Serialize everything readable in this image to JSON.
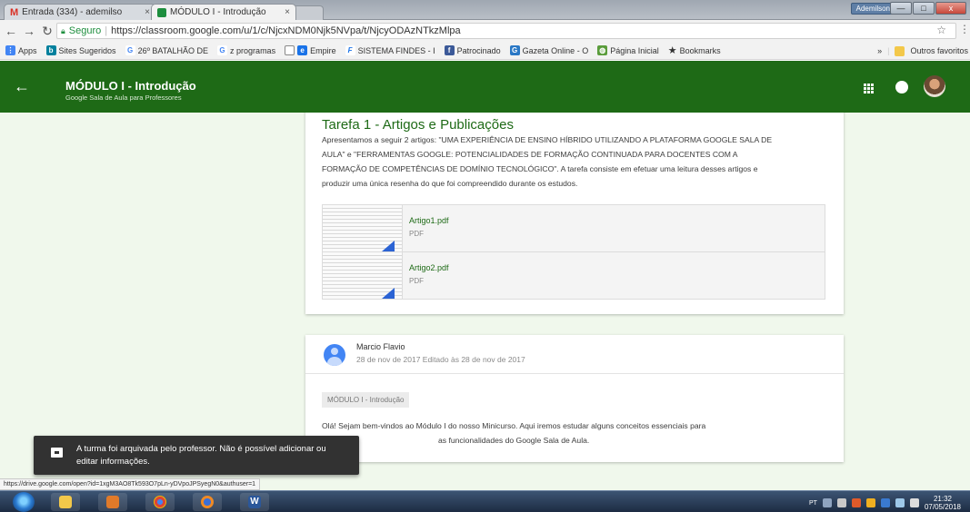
{
  "browser": {
    "tabs": [
      {
        "label": "Entrada (334) - ademilso",
        "icon": "gmail-icon"
      },
      {
        "label": "MÓDULO I - Introdução",
        "icon": "classroom-icon"
      }
    ],
    "user_chip": "Ademilson",
    "window_buttons": {
      "minimize": "—",
      "maximize": "□",
      "close": "x"
    },
    "secure_label": "Seguro",
    "url": "https://classroom.google.com/u/1/c/NjcxNDM0Njk5NVpa/t/NjcyODAzNTkzMlpa",
    "bookmarks": [
      {
        "label": "Apps",
        "icon": "apps-grid-icon",
        "color": "#4285f4"
      },
      {
        "label": "Sites Sugeridos",
        "icon": "bing-icon",
        "color": "#00809d"
      },
      {
        "label": "26º BATALHÃO DE",
        "icon": "google-g-icon",
        "color": "#4285f4"
      },
      {
        "label": "z programas",
        "icon": "google-g-icon",
        "color": "#4285f4"
      },
      {
        "label": "Empire",
        "icon": "page-icon",
        "color": "#888888"
      },
      {
        "label": "SISTEMA FINDES - I",
        "icon": "findes-icon",
        "color": "#1a73e8"
      },
      {
        "label": "Patrocinado",
        "icon": "facebook-icon",
        "color": "#3b5998"
      },
      {
        "label": "Gazeta Online - O",
        "icon": "gazeta-icon",
        "color": "#2a78c5"
      },
      {
        "label": "Página Inicial",
        "icon": "globe-icon",
        "color": "#5a9c3b"
      },
      {
        "label": "Bookmarks",
        "icon": "star-icon",
        "color": "#333333"
      }
    ],
    "bookmarks_more": "»",
    "bookmarks_other": "Outros favoritos"
  },
  "header": {
    "title": "MÓDULO I - Introdução",
    "subtitle": "Google Sala de Aula para Professores"
  },
  "assignment": {
    "title": "Tarefa 1 - Artigos e Publicações",
    "description": "Apresentamos a seguir 2 artigos: \"UMA EXPERIÊNCIA DE ENSINO HÍBRIDO UTILIZANDO A PLATAFORMA GOOGLE SALA DE AULA\" e \"FERRAMENTAS GOOGLE: POTENCIALIDADES DE FORMAÇÃO CONTINUADA PARA DOCENTES COM A FORMAÇÃO DE COMPETÊNCIAS DE DOMÍNIO TECNOLÓGICO\". A tarefa consiste em efetuar uma leitura desses artigos e produzir uma única resenha do que foi compreendido durante os estudos.",
    "attachments": [
      {
        "name": "Artigo1.pdf",
        "type": "PDF"
      },
      {
        "name": "Artigo2.pdf",
        "type": "PDF"
      }
    ]
  },
  "post": {
    "author": "Marcio Flavio",
    "date": "28 de nov de 2017 Editado às 28 de nov de 2017",
    "topic": "MÓDULO I - Introdução",
    "text_line1": "Olá! Sejam bem-vindos ao Módulo I do nosso Minicurso. Aqui iremos estudar alguns conceitos essenciais para",
    "text_line2": "as funcionalidades do Google Sala de Aula."
  },
  "snackbar": {
    "message": "A turma foi arquivada pelo professor. Não é possível adicionar ou editar informações."
  },
  "status_url": "https://drive.google.com/open?id=1xgM3AO8Tk593O7pLn-yDVpoJPSyegN0&authuser=1",
  "taskbar": {
    "tray_lang": "PT",
    "time": "21:32",
    "date": "07/05/2018"
  },
  "colors": {
    "classroom_green": "#1e6a16",
    "page_background": "#f0f8ec",
    "link_green": "#1e6a16"
  }
}
